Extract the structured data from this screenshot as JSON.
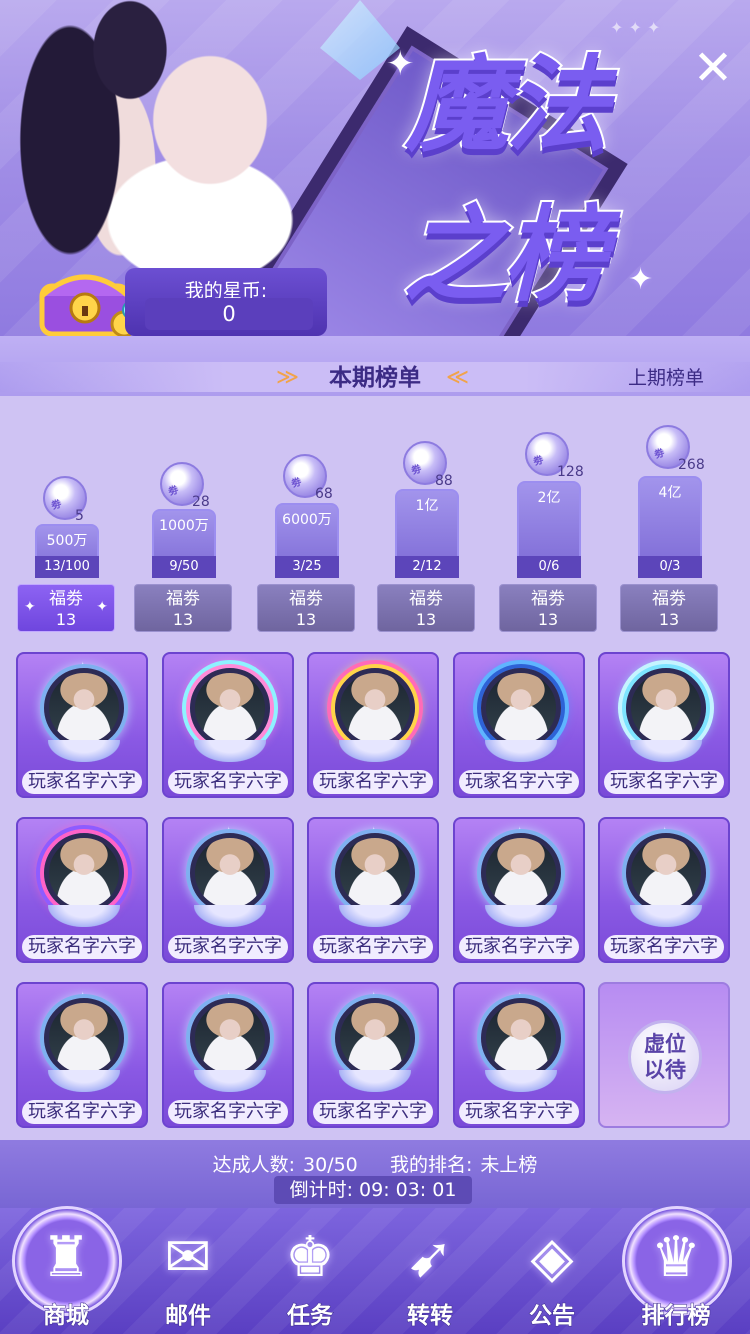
{
  "banner": {
    "title_line1": "魔法",
    "title_line2": "之榜",
    "close_glyph": "✕",
    "my_coins_label": "我的星币:",
    "my_coins_value": "0"
  },
  "tabs": {
    "current": "本期榜单",
    "previous": "上期榜单"
  },
  "tiers": [
    {
      "reward_count": "5",
      "goal": "500万",
      "progress": "13/100",
      "progress_ratio": 0.13,
      "coupon_label": "福劵",
      "coupon_count": "13",
      "active": true
    },
    {
      "reward_count": "28",
      "goal": "1000万",
      "progress": "9/50",
      "progress_ratio": 0.18,
      "coupon_label": "福劵",
      "coupon_count": "13",
      "active": false
    },
    {
      "reward_count": "68",
      "goal": "6000万",
      "progress": "3/25",
      "progress_ratio": 0.12,
      "coupon_label": "福劵",
      "coupon_count": "13",
      "active": false
    },
    {
      "reward_count": "88",
      "goal": "1亿",
      "progress": "2/12",
      "progress_ratio": 0.17,
      "coupon_label": "福劵",
      "coupon_count": "13",
      "active": false
    },
    {
      "reward_count": "128",
      "goal": "2亿",
      "progress": "0/6",
      "progress_ratio": 0.0,
      "coupon_label": "福劵",
      "coupon_count": "13",
      "active": false
    },
    {
      "reward_count": "268",
      "goal": "4亿",
      "progress": "0/3",
      "progress_ratio": 0.0,
      "coupon_label": "福劵",
      "coupon_count": "13",
      "active": false
    }
  ],
  "reward_icon_text": "劵",
  "players": [
    {
      "name": "玩家名字六字",
      "frame": "wing"
    },
    {
      "name": "玩家名字六字",
      "frame": "heart"
    },
    {
      "name": "玩家名字六字",
      "frame": "gold"
    },
    {
      "name": "玩家名字六字",
      "frame": "blue"
    },
    {
      "name": "玩家名字六字",
      "frame": "ice"
    },
    {
      "name": "玩家名字六字",
      "frame": "candy"
    },
    {
      "name": "玩家名字六字",
      "frame": "wing"
    },
    {
      "name": "玩家名字六字",
      "frame": "wing"
    },
    {
      "name": "玩家名字六字",
      "frame": "wing"
    },
    {
      "name": "玩家名字六字",
      "frame": "wing"
    },
    {
      "name": "玩家名字六字",
      "frame": "wing"
    },
    {
      "name": "玩家名字六字",
      "frame": "wing"
    },
    {
      "name": "玩家名字六字",
      "frame": "wing"
    },
    {
      "name": "玩家名字六字",
      "frame": "wing"
    }
  ],
  "placeholder": {
    "line1": "虚位",
    "line2": "以待"
  },
  "stats": {
    "achieved_label": "达成人数:",
    "achieved_value": "30/50",
    "my_rank_label": "我的排名:",
    "my_rank_value": "未上榜",
    "countdown_label": "倒计时:",
    "countdown_value": "09: 03: 01"
  },
  "nav": [
    {
      "label": "商城",
      "icon": "castle-icon",
      "glyph": "♜",
      "highlight": true
    },
    {
      "label": "邮件",
      "icon": "rings-icon",
      "glyph": "✉",
      "highlight": false
    },
    {
      "label": "任务",
      "icon": "figures-icon",
      "glyph": "♚",
      "highlight": false
    },
    {
      "label": "转转",
      "icon": "bow-icon",
      "glyph": "➹",
      "highlight": false
    },
    {
      "label": "公告",
      "icon": "mask-icon",
      "glyph": "◈",
      "highlight": false
    },
    {
      "label": "排行榜",
      "icon": "crest-icon",
      "glyph": "♛",
      "highlight": true
    }
  ]
}
